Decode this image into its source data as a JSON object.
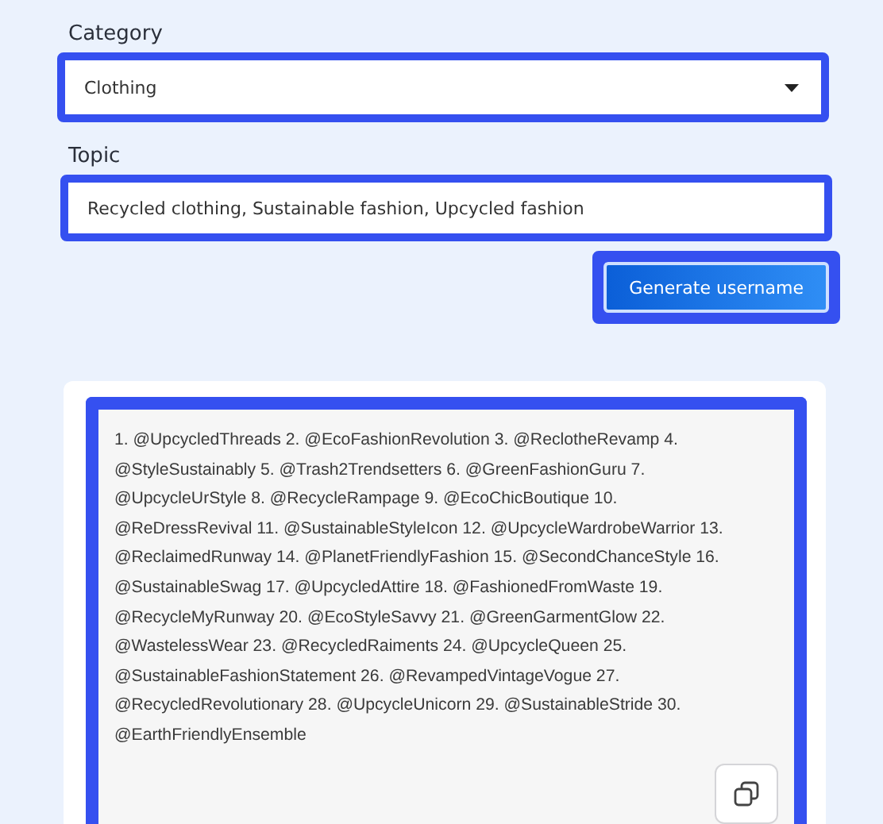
{
  "category": {
    "label": "Category",
    "value": "Clothing"
  },
  "topic": {
    "label": "Topic",
    "value": "Recycled clothing, Sustainable fashion, Upcycled fashion"
  },
  "generate_button": "Generate username",
  "result": {
    "text": "1. @UpcycledThreads 2. @EcoFashionRevolution 3. @ReclotheRevamp 4. @StyleSustainably 5. @Trash2Trendsetters 6. @GreenFashionGuru 7. @UpcycleUrStyle 8. @RecycleRampage 9. @EcoChicBoutique 10. @ReDressRevival 11. @SustainableStyleIcon 12. @UpcycleWardrobeWarrior 13. @ReclaimedRunway 14. @PlanetFriendlyFashion 15. @SecondChanceStyle 16. @SustainableSwag 17. @UpcycledAttire 18. @FashionedFromWaste 19. @RecycleMyRunway 20. @EcoStyleSavvy 21. @GreenGarmentGlow 22. @WastelessWear 23. @RecycledRaiments 24. @UpcycleQueen 25. @SustainableFashionStatement 26. @RevampedVintageVogue 27. @RecycledRevolutionary 28. @UpcycleUnicorn 29. @SustainableStride 30. @EarthFriendlyEnsemble"
  }
}
